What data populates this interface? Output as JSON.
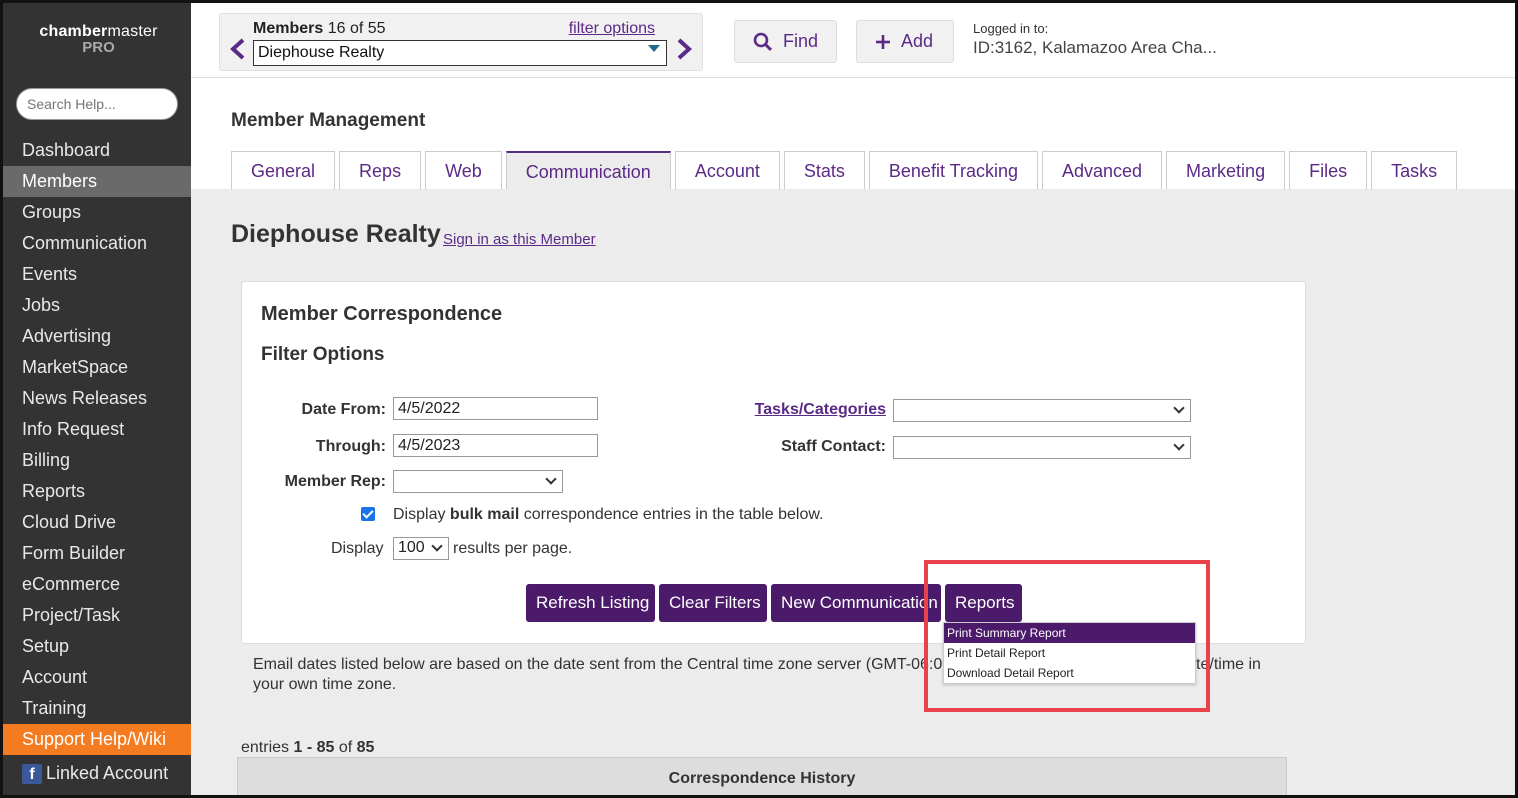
{
  "logo": {
    "part1": "chamber",
    "part2": "master",
    "sub": "PRO"
  },
  "search_help": {
    "placeholder": "Search Help..."
  },
  "nav": {
    "items": [
      "Dashboard",
      "Members",
      "Groups",
      "Communication",
      "Events",
      "Jobs",
      "Advertising",
      "MarketSpace",
      "News Releases",
      "Info Request",
      "Billing",
      "Reports",
      "Cloud Drive",
      "Form Builder",
      "eCommerce",
      "Project/Task",
      "Setup",
      "Account",
      "Training",
      "Support Help/Wiki"
    ],
    "active": "Members",
    "linked_account": "Linked Account"
  },
  "member_nav": {
    "label": "Members",
    "count": "16 of 55",
    "filter_link": "filter options",
    "selected": "Diephouse Realty"
  },
  "toolbar": {
    "find": "Find",
    "add": "Add"
  },
  "login": {
    "label": "Logged in to:",
    "value": "ID:3162, Kalamazoo Area Cha..."
  },
  "page": {
    "title": "Member Management",
    "tabs": [
      "General",
      "Reps",
      "Web",
      "Communication",
      "Account",
      "Stats",
      "Benefit Tracking",
      "Advanced",
      "Marketing",
      "Files",
      "Tasks"
    ],
    "active_tab": "Communication",
    "member_name": "Diephouse Realty",
    "sign_in_link": "Sign in as this Member"
  },
  "correspondence": {
    "title": "Member Correspondence",
    "filter_title": "Filter Options",
    "date_from_label": "Date From:",
    "date_from": "4/5/2022",
    "through_label": "Through:",
    "through": "4/5/2023",
    "member_rep_label": "Member Rep:",
    "tasks_label": "Tasks/Categories",
    "staff_label": "Staff Contact:",
    "bulk_pre": "Display",
    "bulk_bold": "bulk mail",
    "bulk_post": "correspondence entries in the table below.",
    "display_label": "Display",
    "per_page": "100",
    "per_page_suffix": "results per page.",
    "buttons": {
      "refresh": "Refresh Listing",
      "clear": "Clear Filters",
      "new": "New Communication",
      "reports": "Reports"
    },
    "report_menu": [
      "Print Summary Report",
      "Print Detail Report",
      "Download Detail Report"
    ]
  },
  "note": {
    "before": "Email dates listed below are based on the date sent from the Central time zone server (GMT-06:0",
    "after": "date/time in your own time zone."
  },
  "entries": {
    "prefix": "entries",
    "range": "1 - 85",
    "of": "of",
    "total": "85"
  },
  "history": {
    "title": "Correspondence History"
  },
  "colors": {
    "brand": "#4b1a6b",
    "link": "#5b2a86",
    "support": "#f47b20",
    "highlight": "#e8434b"
  }
}
